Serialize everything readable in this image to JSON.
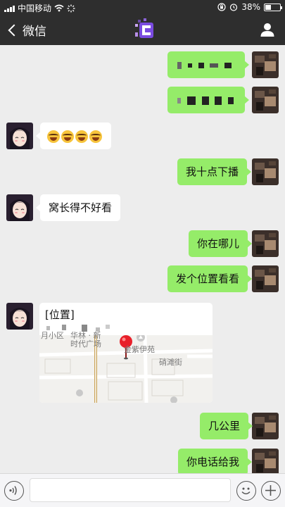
{
  "status_bar": {
    "carrier": "中国移动",
    "time": "",
    "battery": "38%",
    "battery_level": 0.38
  },
  "nav": {
    "back_label": "微信",
    "icons": [
      "chevron-left-icon",
      "contact-avatar",
      "person-icon"
    ]
  },
  "messages": [
    {
      "sender": "me",
      "kind": "text",
      "text": ""
    },
    {
      "sender": "me",
      "kind": "text",
      "text": ""
    },
    {
      "sender": "them",
      "kind": "emoji",
      "emoji": [
        "laughing-tears",
        "laughing-tears",
        "laughing-tears",
        "laughing-tears"
      ]
    },
    {
      "sender": "me",
      "kind": "text",
      "text": "我十点下播"
    },
    {
      "sender": "them",
      "kind": "text",
      "text": "窝长得不好看"
    },
    {
      "sender": "me",
      "kind": "text",
      "text": "你在哪儿"
    },
    {
      "sender": "me",
      "kind": "text",
      "text": "发个位置看看"
    },
    {
      "sender": "them",
      "kind": "location",
      "header": "[位置]",
      "map_labels": [
        "月小区",
        "华林 · 新",
        "时代广场",
        "金紫伊苑",
        "硝滩街"
      ]
    },
    {
      "sender": "me",
      "kind": "text",
      "text": "几公里"
    },
    {
      "sender": "me",
      "kind": "text",
      "text": "你电话给我"
    }
  ],
  "input_bar": {
    "placeholder": "",
    "icons": [
      "voice-icon",
      "emoji-icon",
      "plus-icon"
    ]
  },
  "colors": {
    "nav_bg": "#2e2e2e",
    "chat_bg": "#ededed",
    "my_bubble": "#95ec69",
    "their_bubble": "#ffffff"
  }
}
